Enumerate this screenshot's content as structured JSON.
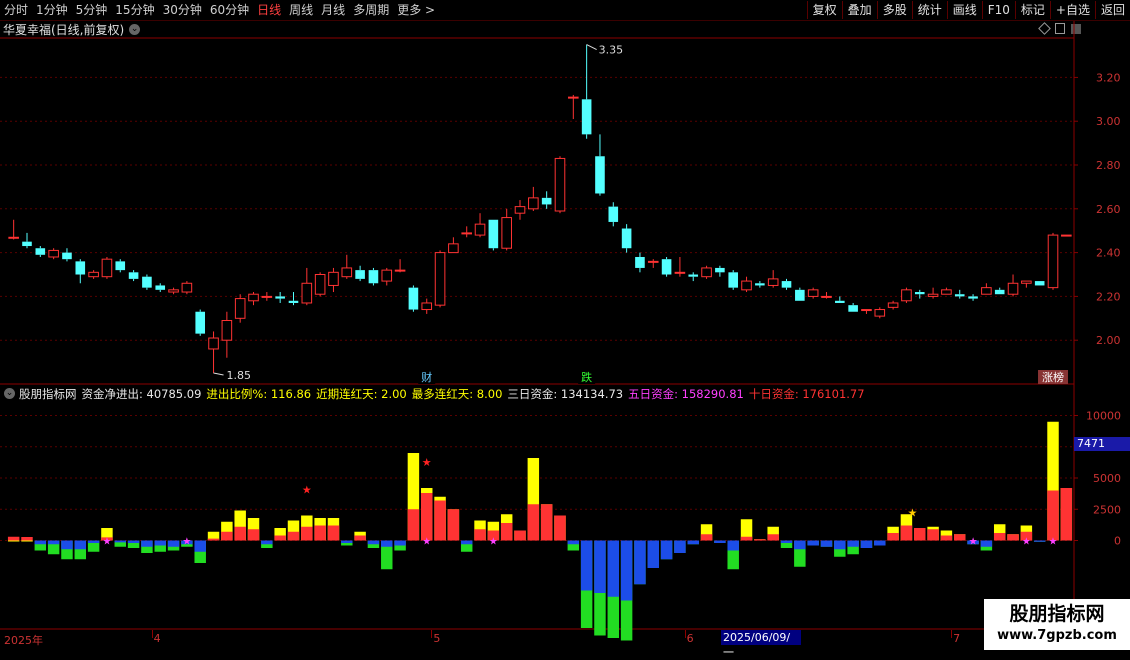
{
  "toolbar": {
    "periods": [
      "分时",
      "1分钟",
      "5分钟",
      "15分钟",
      "30分钟",
      "60分钟",
      "日线",
      "周线",
      "月线",
      "多周期",
      "更多 >"
    ],
    "active_period": "日线",
    "actions": [
      "复权",
      "叠加",
      "多股",
      "统计",
      "画线",
      "F10",
      "标记",
      "+自选",
      "返回"
    ]
  },
  "stock": {
    "name": "华夏幸福(日线,前复权)"
  },
  "colors": {
    "up": "#ff3333",
    "down": "#54ffff",
    "yellow": "#ffff00",
    "blue": "#1c4de8",
    "green": "#22dd22",
    "axis": "#8b0000",
    "grid": "#5a0000",
    "magenta": "#ff40ff"
  },
  "price_axis": {
    "ticks": [
      "3.20",
      "3.00",
      "2.80",
      "2.60",
      "2.40",
      "2.20",
      "2.00"
    ]
  },
  "price_chart": {
    "ymin": 1.8,
    "ymax": 3.38,
    "high_annotation": "3.35",
    "low_annotation": "1.85",
    "markers": [
      {
        "index": 31,
        "label": "财"
      },
      {
        "index": 43,
        "label": "跌"
      },
      {
        "index": 78,
        "label": "涨榜"
      }
    ],
    "candles": [
      [
        2.47,
        2.47,
        2.55,
        2.46
      ],
      [
        2.45,
        2.43,
        2.49,
        2.42
      ],
      [
        2.42,
        2.39,
        2.43,
        2.38
      ],
      [
        2.38,
        2.41,
        2.42,
        2.37
      ],
      [
        2.4,
        2.37,
        2.42,
        2.36
      ],
      [
        2.36,
        2.3,
        2.37,
        2.26
      ],
      [
        2.29,
        2.31,
        2.32,
        2.28
      ],
      [
        2.29,
        2.37,
        2.38,
        2.28
      ],
      [
        2.36,
        2.32,
        2.37,
        2.31
      ],
      [
        2.31,
        2.28,
        2.32,
        2.27
      ],
      [
        2.29,
        2.24,
        2.3,
        2.23
      ],
      [
        2.25,
        2.23,
        2.26,
        2.22
      ],
      [
        2.22,
        2.23,
        2.24,
        2.21
      ],
      [
        2.22,
        2.26,
        2.27,
        2.21
      ],
      [
        2.13,
        2.03,
        2.14,
        2.02
      ],
      [
        1.96,
        2.01,
        2.04,
        1.85
      ],
      [
        2.0,
        2.09,
        2.13,
        1.92
      ],
      [
        2.1,
        2.19,
        2.21,
        2.08
      ],
      [
        2.18,
        2.21,
        2.22,
        2.16
      ],
      [
        2.2,
        2.2,
        2.22,
        2.18
      ],
      [
        2.2,
        2.19,
        2.22,
        2.17
      ],
      [
        2.18,
        2.17,
        2.22,
        2.16
      ],
      [
        2.17,
        2.26,
        2.33,
        2.16
      ],
      [
        2.21,
        2.3,
        2.31,
        2.2
      ],
      [
        2.25,
        2.31,
        2.33,
        2.22
      ],
      [
        2.29,
        2.33,
        2.39,
        2.28
      ],
      [
        2.32,
        2.28,
        2.34,
        2.27
      ],
      [
        2.32,
        2.26,
        2.33,
        2.25
      ],
      [
        2.27,
        2.32,
        2.33,
        2.25
      ],
      [
        2.32,
        2.32,
        2.37,
        2.31
      ],
      [
        2.24,
        2.14,
        2.25,
        2.13
      ],
      [
        2.14,
        2.17,
        2.19,
        2.12
      ],
      [
        2.16,
        2.4,
        2.41,
        2.15
      ],
      [
        2.4,
        2.44,
        2.47,
        2.4
      ],
      [
        2.49,
        2.49,
        2.52,
        2.47
      ],
      [
        2.48,
        2.53,
        2.58,
        2.47
      ],
      [
        2.55,
        2.42,
        2.55,
        2.41
      ],
      [
        2.42,
        2.56,
        2.6,
        2.41
      ],
      [
        2.58,
        2.61,
        2.64,
        2.55
      ],
      [
        2.6,
        2.65,
        2.7,
        2.59
      ],
      [
        2.65,
        2.62,
        2.68,
        2.6
      ],
      [
        2.59,
        2.83,
        2.84,
        2.58
      ],
      [
        3.11,
        3.11,
        3.12,
        3.01
      ],
      [
        3.1,
        2.94,
        3.35,
        2.92
      ],
      [
        2.84,
        2.67,
        2.94,
        2.66
      ],
      [
        2.61,
        2.54,
        2.63,
        2.52
      ],
      [
        2.51,
        2.42,
        2.53,
        2.4
      ],
      [
        2.38,
        2.33,
        2.4,
        2.31
      ],
      [
        2.36,
        2.36,
        2.37,
        2.33
      ],
      [
        2.37,
        2.3,
        2.38,
        2.29
      ],
      [
        2.31,
        2.31,
        2.38,
        2.29
      ],
      [
        2.3,
        2.29,
        2.31,
        2.27
      ],
      [
        2.29,
        2.33,
        2.34,
        2.28
      ],
      [
        2.33,
        2.31,
        2.34,
        2.29
      ],
      [
        2.31,
        2.24,
        2.32,
        2.23
      ],
      [
        2.23,
        2.27,
        2.29,
        2.22
      ],
      [
        2.26,
        2.25,
        2.27,
        2.24
      ],
      [
        2.25,
        2.28,
        2.32,
        2.24
      ],
      [
        2.27,
        2.24,
        2.28,
        2.23
      ],
      [
        2.23,
        2.18,
        2.24,
        2.18
      ],
      [
        2.2,
        2.23,
        2.24,
        2.19
      ],
      [
        2.2,
        2.2,
        2.22,
        2.19
      ],
      [
        2.18,
        2.17,
        2.2,
        2.17
      ],
      [
        2.16,
        2.13,
        2.17,
        2.13
      ],
      [
        2.14,
        2.14,
        2.14,
        2.12
      ],
      [
        2.11,
        2.14,
        2.15,
        2.1
      ],
      [
        2.15,
        2.17,
        2.18,
        2.14
      ],
      [
        2.18,
        2.23,
        2.24,
        2.17
      ],
      [
        2.22,
        2.21,
        2.23,
        2.19
      ],
      [
        2.2,
        2.21,
        2.24,
        2.19
      ],
      [
        2.21,
        2.23,
        2.24,
        2.21
      ],
      [
        2.21,
        2.2,
        2.23,
        2.19
      ],
      [
        2.2,
        2.19,
        2.21,
        2.18
      ],
      [
        2.21,
        2.24,
        2.26,
        2.21
      ],
      [
        2.23,
        2.21,
        2.24,
        2.21
      ],
      [
        2.21,
        2.26,
        2.3,
        2.2
      ],
      [
        2.26,
        2.27,
        2.27,
        2.24
      ],
      [
        2.27,
        2.25,
        2.27,
        2.25
      ],
      [
        2.24,
        2.48,
        2.49,
        2.23
      ],
      [
        2.48,
        2.48,
        2.48,
        2.48
      ]
    ]
  },
  "indicator": {
    "name": "股朋指标网",
    "items": [
      {
        "text": "资金净进出: 40785.09",
        "color": "#e8e8e8"
      },
      {
        "text": "进出比例%: 116.86",
        "color": "#ffff00"
      },
      {
        "text": "近期连红天: 2.00",
        "color": "#ffff00"
      },
      {
        "text": "最多连红天: 8.00",
        "color": "#ffff00"
      },
      {
        "text": "三日资金: 134134.73",
        "color": "#e8e8e8"
      },
      {
        "text": "五日资金: 158290.81",
        "color": "#ff40ff"
      },
      {
        "text": "十日资金: 176101.77",
        "color": "#ff3333"
      }
    ],
    "axis_ticks": [
      "10000",
      "7500",
      "5000",
      "2500",
      "0"
    ],
    "ymin": -7000,
    "ymax": 11000,
    "price_tag": "7471",
    "bars": [
      [
        300,
        0
      ],
      [
        280,
        0
      ],
      [
        -300,
        -800
      ],
      [
        -300,
        -1100
      ],
      [
        -700,
        -1500
      ],
      [
        -700,
        -1500
      ],
      [
        -200,
        -900
      ],
      [
        250,
        1000
      ],
      [
        -150,
        -500
      ],
      [
        -200,
        -600
      ],
      [
        -500,
        -1000
      ],
      [
        -400,
        -900
      ],
      [
        -500,
        -800
      ],
      [
        -300,
        -500
      ],
      [
        -900,
        -1800
      ],
      [
        150,
        700
      ],
      [
        700,
        1500
      ],
      [
        1100,
        2400
      ],
      [
        900,
        1800
      ],
      [
        -300,
        -600
      ],
      [
        400,
        1000
      ],
      [
        700,
        1600
      ],
      [
        1100,
        2000
      ],
      [
        1200,
        1800
      ],
      [
        1200,
        1800
      ],
      [
        -200,
        -400
      ],
      [
        400,
        700
      ],
      [
        -300,
        -600
      ],
      [
        -500,
        -2300
      ],
      [
        -400,
        -800
      ],
      [
        2500,
        7000
      ],
      [
        3800,
        4200
      ],
      [
        3200,
        3500
      ],
      [
        2500,
        2500
      ],
      [
        -300,
        -900
      ],
      [
        900,
        1600
      ],
      [
        800,
        1500
      ],
      [
        1400,
        2100
      ],
      [
        800,
        800
      ],
      [
        2900,
        6600
      ],
      [
        2900,
        2900
      ],
      [
        2000,
        2000
      ],
      [
        -300,
        -800
      ],
      [
        -4000,
        -7000
      ],
      [
        -4200,
        -7600
      ],
      [
        -4500,
        -7800
      ],
      [
        -4800,
        -8000
      ],
      [
        -3500,
        -3500
      ],
      [
        -2200,
        -2200
      ],
      [
        -1500,
        -1500
      ],
      [
        -1000,
        -1000
      ],
      [
        -300,
        -300
      ],
      [
        500,
        1300
      ],
      [
        -200,
        -200
      ],
      [
        -800,
        -2300
      ],
      [
        300,
        1700
      ],
      [
        100,
        100
      ],
      [
        500,
        1100
      ],
      [
        -200,
        -600
      ],
      [
        -700,
        -2100
      ],
      [
        -400,
        -400
      ],
      [
        -500,
        -500
      ],
      [
        -700,
        -1300
      ],
      [
        -500,
        -1100
      ],
      [
        -600,
        -600
      ],
      [
        -400,
        -400
      ],
      [
        600,
        1100
      ],
      [
        1200,
        2100
      ],
      [
        1000,
        1000
      ],
      [
        900,
        1100
      ],
      [
        400,
        800
      ],
      [
        500,
        500
      ],
      [
        -300,
        -300
      ],
      [
        -500,
        -800
      ],
      [
        600,
        1300
      ],
      [
        500,
        500
      ],
      [
        700,
        1200
      ],
      [
        -100,
        -100
      ],
      [
        4000,
        9500
      ],
      [
        4200,
        4200
      ]
    ],
    "pink_markers": [
      7,
      13,
      31,
      36,
      72,
      76,
      78
    ],
    "red_stars": [
      22,
      31
    ],
    "yellow_stars": [
      67
    ]
  },
  "date_axis": {
    "labels": [
      {
        "text": "2025年",
        "index": 0
      },
      {
        "text": "4",
        "index": 11
      },
      {
        "text": "5",
        "index": 32
      },
      {
        "text": "6",
        "index": 51
      },
      {
        "text": "7",
        "index": 71
      }
    ],
    "selected": "2025/06/09/一"
  },
  "watermark": {
    "title": "股朋指标网",
    "url": "www.7gpzb.com"
  }
}
